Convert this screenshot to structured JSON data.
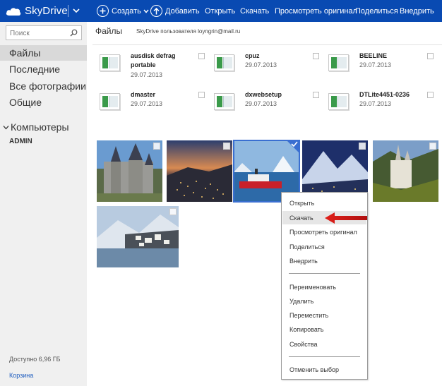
{
  "topbar": {
    "brand": "SkyDrive",
    "brand_color": "#094ab2",
    "buttons": [
      {
        "label": "Создать",
        "icon": "plus-icon"
      },
      {
        "label": "Добавить",
        "icon": "upload-icon"
      },
      {
        "label": "Открыть"
      },
      {
        "label": "Скачать"
      },
      {
        "label": "Просмотреть оригинал"
      },
      {
        "label": "Поделиться"
      },
      {
        "label": "Внедрить"
      }
    ]
  },
  "sidebar": {
    "search_placeholder": "Поиск",
    "items": [
      "Файлы",
      "Последние",
      "Все фотографии",
      "Общие"
    ],
    "computers_label": "Компьютеры",
    "computer_name": "ADMIN",
    "storage": "Доступно 6,96 ГБ",
    "recycle_bin": "Корзина"
  },
  "main": {
    "breadcrumb": "Файлы",
    "owner": "SkyDrive пользователя loyngrin@mail.ru",
    "files": [
      {
        "name": "ausdisk defrag portable",
        "date": "29.07.2013"
      },
      {
        "name": "cpuz",
        "date": "29.07.2013"
      },
      {
        "name": "BEELINE",
        "date": "29.07.2013"
      },
      {
        "name": "dmaster",
        "date": "29.07.2013"
      },
      {
        "name": "dxwebsetup",
        "date": "29.07.2013"
      },
      {
        "name": "DTLite4451-0236",
        "date": "29.07.2013"
      }
    ],
    "photos": [
      {
        "subject": "castle",
        "selected": false
      },
      {
        "subject": "night-coastal-city",
        "selected": false
      },
      {
        "subject": "ship-icebergs",
        "selected": true
      },
      {
        "subject": "mountain-night-town",
        "selected": false
      },
      {
        "subject": "castle-forest",
        "selected": false
      },
      {
        "subject": "lake-village-winter",
        "selected": false
      }
    ]
  },
  "context_menu": {
    "items_group1": [
      "Открыть",
      "Скачать",
      "Просмотреть оригинал",
      "Поделиться",
      "Внедрить"
    ],
    "items_group2": [
      "Переименовать",
      "Удалить",
      "Переместить",
      "Копировать",
      "Свойства"
    ],
    "items_group3": [
      "Отменить выбор"
    ],
    "highlighted": "Скачать"
  },
  "colors": {
    "accent": "#094ab2",
    "selection": "#3a6fd1",
    "arrow": "#e0201a",
    "sidebar_bg": "#f0f0f0",
    "link": "#1e5dbf"
  }
}
